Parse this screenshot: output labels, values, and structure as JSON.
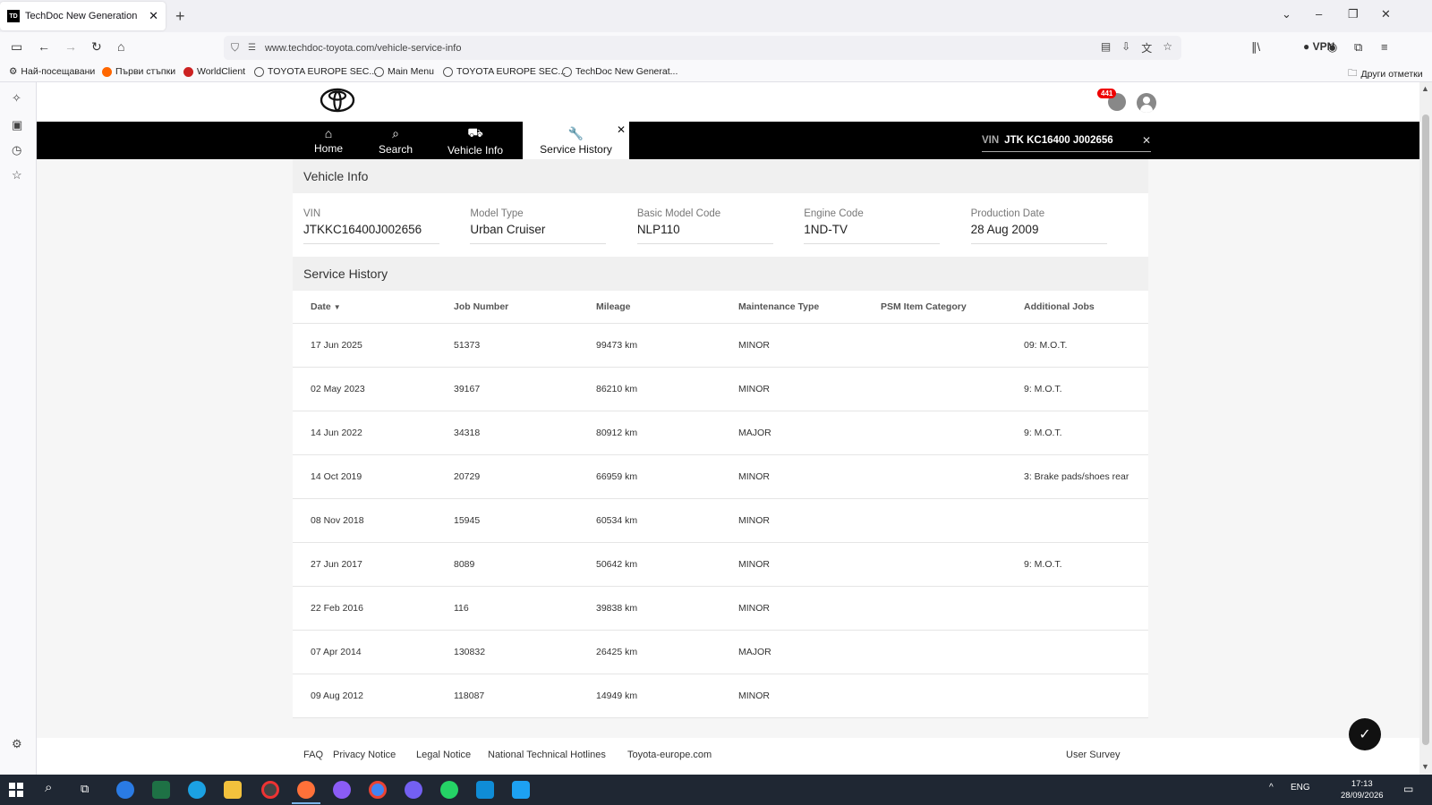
{
  "browser": {
    "tab_title": "TechDoc New Generation",
    "tab_favicon": "TD",
    "url": "www.techdoc-toyota.com/vehicle-service-info",
    "vpn_label": "VPN",
    "bookmarks": [
      {
        "label": "Най-посещавани",
        "icon": "gear-icon"
      },
      {
        "label": "Първи стъпки",
        "icon": "firefox-icon"
      },
      {
        "label": "WorldClient",
        "icon": "worldclient-icon"
      },
      {
        "label": "TOYOTA EUROPE SEC...",
        "icon": "globe-icon"
      },
      {
        "label": "Main Menu",
        "icon": "globe-icon"
      },
      {
        "label": "TOYOTA EUROPE SEC...",
        "icon": "globe-icon"
      },
      {
        "label": "TechDoc New Generat...",
        "icon": "globe-icon"
      }
    ],
    "other_bookmarks": "Други отметки"
  },
  "header": {
    "notification_count": "441"
  },
  "menu": {
    "items": [
      {
        "label": "Home",
        "icon": "home-icon"
      },
      {
        "label": "Search",
        "icon": "search-icon"
      },
      {
        "label": "Vehicle Info",
        "icon": "car-icon"
      },
      {
        "label": "Service History",
        "icon": "wrench-icon"
      }
    ],
    "vin_label": "VIN",
    "vin_value": "JTK KC16400 J002656"
  },
  "vehicle_info": {
    "title": "Vehicle Info",
    "fields": [
      {
        "label": "VIN",
        "value": "JTKKC16400J002656"
      },
      {
        "label": "Model Type",
        "value": "Urban Cruiser"
      },
      {
        "label": "Basic Model Code",
        "value": "NLP110"
      },
      {
        "label": "Engine Code",
        "value": "1ND-TV"
      },
      {
        "label": "Production Date",
        "value": "28 Aug 2009"
      }
    ]
  },
  "service_history": {
    "title": "Service History",
    "columns": [
      "Date",
      "Job Number",
      "Mileage",
      "Maintenance Type",
      "PSM Item Category",
      "Additional Jobs"
    ],
    "rows": [
      [
        "17 Jun 2025",
        "51373",
        "99473 km",
        "MINOR",
        "",
        "09: M.O.T."
      ],
      [
        "02 May 2023",
        "39167",
        "86210 km",
        "MINOR",
        "",
        "9: M.O.T."
      ],
      [
        "14 Jun 2022",
        "34318",
        "80912 km",
        "MAJOR",
        "",
        "9: M.O.T."
      ],
      [
        "14 Oct 2019",
        "20729",
        "66959 km",
        "MINOR",
        "",
        "3: Brake pads/shoes rear"
      ],
      [
        "08 Nov 2018",
        "15945",
        "60534 km",
        "MINOR",
        "",
        ""
      ],
      [
        "27 Jun 2017",
        "8089",
        "50642 km",
        "MINOR",
        "",
        "9: M.O.T."
      ],
      [
        "22 Feb 2016",
        "116",
        "39838 km",
        "MINOR",
        "",
        ""
      ],
      [
        "07 Apr 2014",
        "130832",
        "26425 km",
        "MAJOR",
        "",
        ""
      ],
      [
        "09 Aug 2012",
        "118087",
        "14949 km",
        "MINOR",
        "",
        ""
      ]
    ]
  },
  "footer": {
    "links": [
      "FAQ",
      "Privacy Notice",
      "Legal Notice",
      "National Technical Hotlines",
      "Toyota-europe.com"
    ],
    "survey": "User Survey"
  },
  "taskbar": {
    "lang": "ENG",
    "time": "17:13",
    "date": "28/09/2026"
  }
}
